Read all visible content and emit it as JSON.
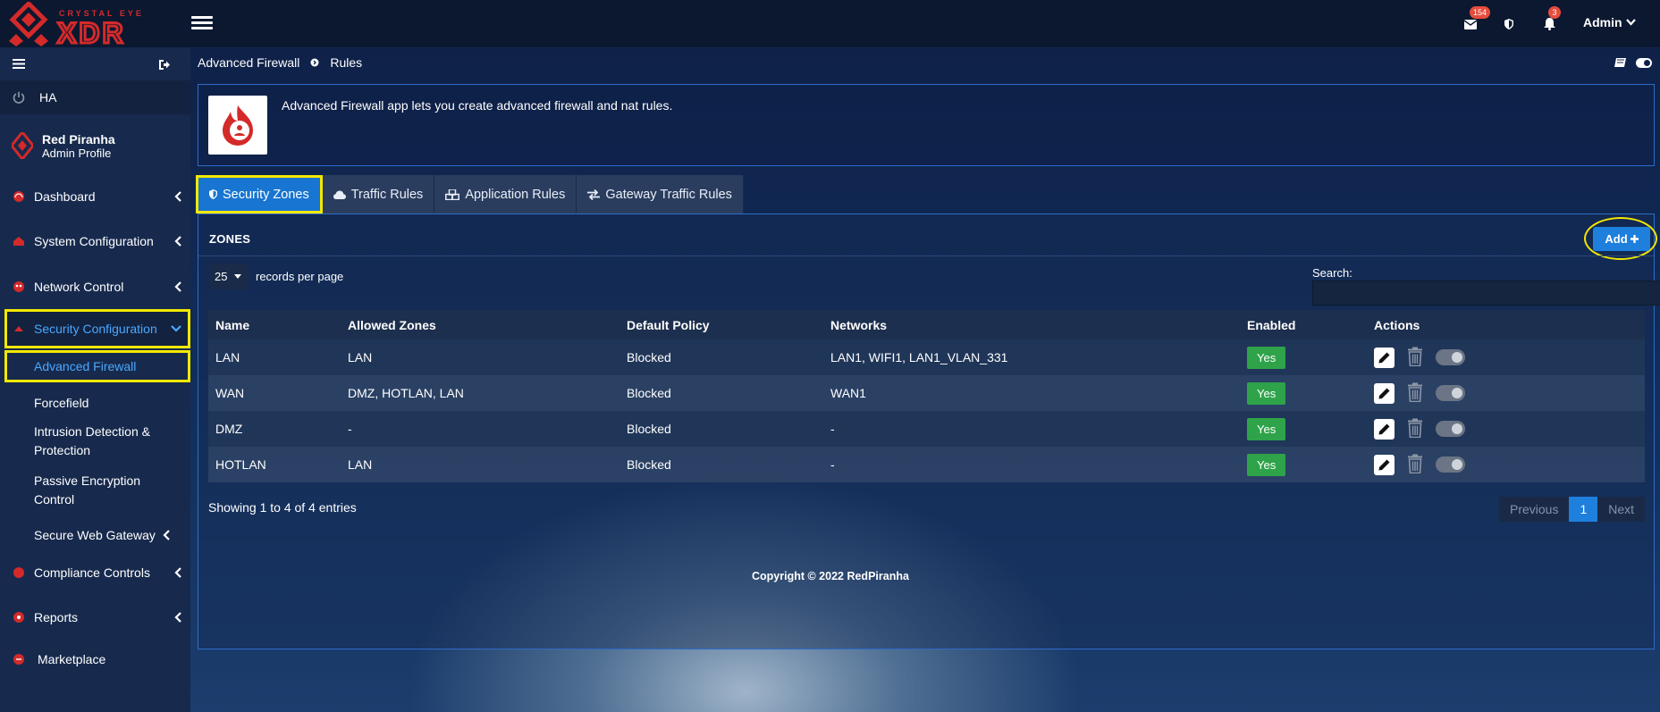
{
  "app": {
    "brand_top": "CRYSTAL EYE",
    "brand_main": "XDR"
  },
  "topbar": {
    "mail_count": "154",
    "alerts_count": "3",
    "user": "Admin"
  },
  "sidebar": {
    "ha": "HA",
    "profile_name": "Red Piranha",
    "profile_role": "Admin Profile",
    "items": [
      {
        "label": "Dashboard"
      },
      {
        "label": "System Configuration"
      },
      {
        "label": "Network Control"
      },
      {
        "label": "Security Configuration"
      },
      {
        "label": "Compliance Controls"
      },
      {
        "label": "Reports"
      },
      {
        "label": "Marketplace"
      }
    ],
    "sub": [
      {
        "label": "Advanced Firewall"
      },
      {
        "label": "Forcefield"
      },
      {
        "label": "Intrusion Detection &",
        "label2": "Protection"
      },
      {
        "label": "Passive Encryption",
        "label2": "Control"
      },
      {
        "label": "Secure Web Gateway"
      }
    ]
  },
  "breadcrumb": [
    "Advanced Firewall",
    "Rules"
  ],
  "info": {
    "desc": "Advanced Firewall app lets you create advanced firewall and nat rules."
  },
  "tabs": [
    "Security Zones",
    "Traffic Rules",
    "Application Rules",
    "Gateway Traffic Rules"
  ],
  "panel": {
    "title": "ZONES",
    "add": "Add",
    "records_value": "25",
    "records_label": "records per page",
    "search_label": "Search:",
    "search_value": ""
  },
  "table": {
    "headers": [
      "Name",
      "Allowed Zones",
      "Default Policy",
      "Networks",
      "Enabled",
      "Actions"
    ],
    "rows": [
      {
        "name": "LAN",
        "allowed": "LAN",
        "policy": "Blocked",
        "networks": "LAN1, WIFI1, LAN1_VLAN_331",
        "enabled": "Yes"
      },
      {
        "name": "WAN",
        "allowed": "DMZ, HOTLAN, LAN",
        "policy": "Blocked",
        "networks": "WAN1",
        "enabled": "Yes"
      },
      {
        "name": "DMZ",
        "allowed": "-",
        "policy": "Blocked",
        "networks": "-",
        "enabled": "Yes"
      },
      {
        "name": "HOTLAN",
        "allowed": "LAN",
        "policy": "Blocked",
        "networks": "-",
        "enabled": "Yes"
      }
    ]
  },
  "showing": "Showing 1 to 4 of 4 entries",
  "pager": {
    "prev": "Previous",
    "page": "1",
    "next": "Next"
  },
  "footer": "Copyright © 2022 RedPiranha",
  "colors": {
    "accent": "#1e7fdd",
    "highlight": "#f4e800",
    "brand_red": "#d42a2a",
    "enabled_green": "#2fa34a"
  }
}
